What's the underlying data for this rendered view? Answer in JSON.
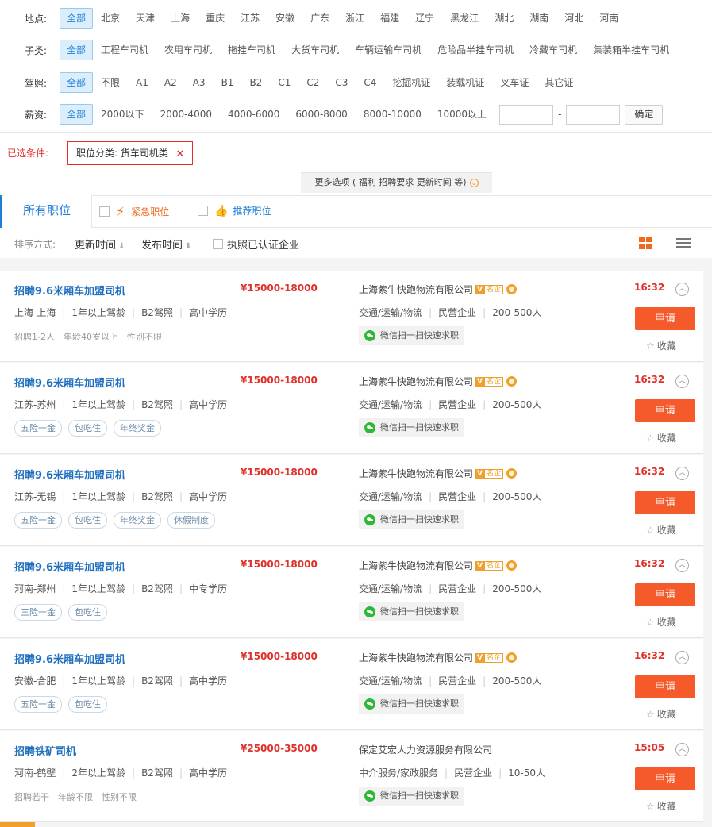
{
  "filters": {
    "location": {
      "label": "地点:",
      "options": [
        "全部",
        "北京",
        "天津",
        "上海",
        "重庆",
        "江苏",
        "安徽",
        "广东",
        "浙江",
        "福建",
        "辽宁",
        "黑龙江",
        "湖北",
        "湖南",
        "河北",
        "河南"
      ]
    },
    "subcategory": {
      "label": "子类:",
      "options": [
        "全部",
        "工程车司机",
        "农用车司机",
        "拖挂车司机",
        "大货车司机",
        "车辆运输车司机",
        "危险品半挂车司机",
        "冷藏车司机",
        "集装箱半挂车司机"
      ]
    },
    "license": {
      "label": "驾照:",
      "options": [
        "全部",
        "不限",
        "A1",
        "A2",
        "A3",
        "B1",
        "B2",
        "C1",
        "C2",
        "C3",
        "C4",
        "挖掘机证",
        "装载机证",
        "叉车证",
        "其它证"
      ]
    },
    "salary": {
      "label": "薪资:",
      "options": [
        "全部",
        "2000以下",
        "2000-4000",
        "4000-6000",
        "6000-8000",
        "8000-10000",
        "10000以上"
      ],
      "dash": "-",
      "confirm_label": "确定"
    }
  },
  "selected": {
    "label": "已选条件:",
    "tag": "职位分类: 货车司机类",
    "remove": "×"
  },
  "more_options": "更多选项 ( 福利 招聘要求 更新时间 等)",
  "tabs": {
    "all": "所有职位",
    "urgent": "紧急职位",
    "recommend": "推荐职位"
  },
  "sort": {
    "label": "排序方式:",
    "update_time": "更新时间",
    "publish_time": "发布时间",
    "certified": "执照已认证企业",
    "arrow": "⬇"
  },
  "jobs": [
    {
      "title": "招聘9.6米厢车加盟司机",
      "salary": "¥15000-18000",
      "location": "上海-上海",
      "experience": "1年以上驾龄",
      "license": "B2驾照",
      "education": "高中学历",
      "extra": [
        "招聘1-2人",
        "年龄40岁以上",
        "性别不限"
      ],
      "tags": [],
      "company": "上海紫牛快跑物流有限公司",
      "badge": "名企",
      "industry": "交通/运输/物流",
      "ownership": "民营企业",
      "size": "200-500人",
      "wechat": "微信扫一扫快速求职",
      "time": "16:32",
      "apply": "申请",
      "fav": "收藏"
    },
    {
      "title": "招聘9.6米厢车加盟司机",
      "salary": "¥15000-18000",
      "location": "江苏-苏州",
      "experience": "1年以上驾龄",
      "license": "B2驾照",
      "education": "高中学历",
      "extra": [],
      "tags": [
        "五险一金",
        "包吃住",
        "年终奖金"
      ],
      "company": "上海紫牛快跑物流有限公司",
      "badge": "名企",
      "industry": "交通/运输/物流",
      "ownership": "民营企业",
      "size": "200-500人",
      "wechat": "微信扫一扫快速求职",
      "time": "16:32",
      "apply": "申请",
      "fav": "收藏"
    },
    {
      "title": "招聘9.6米厢车加盟司机",
      "salary": "¥15000-18000",
      "location": "江苏-无锡",
      "experience": "1年以上驾龄",
      "license": "B2驾照",
      "education": "高中学历",
      "extra": [],
      "tags": [
        "五险一金",
        "包吃住",
        "年终奖金",
        "休假制度"
      ],
      "company": "上海紫牛快跑物流有限公司",
      "badge": "名企",
      "industry": "交通/运输/物流",
      "ownership": "民营企业",
      "size": "200-500人",
      "wechat": "微信扫一扫快速求职",
      "time": "16:32",
      "apply": "申请",
      "fav": "收藏"
    },
    {
      "title": "招聘9.6米厢车加盟司机",
      "salary": "¥15000-18000",
      "location": "河南-郑州",
      "experience": "1年以上驾龄",
      "license": "B2驾照",
      "education": "中专学历",
      "extra": [],
      "tags": [
        "三险一金",
        "包吃住"
      ],
      "company": "上海紫牛快跑物流有限公司",
      "badge": "名企",
      "industry": "交通/运输/物流",
      "ownership": "民营企业",
      "size": "200-500人",
      "wechat": "微信扫一扫快速求职",
      "time": "16:32",
      "apply": "申请",
      "fav": "收藏"
    },
    {
      "title": "招聘9.6米厢车加盟司机",
      "salary": "¥15000-18000",
      "location": "安徽-合肥",
      "experience": "1年以上驾龄",
      "license": "B2驾照",
      "education": "高中学历",
      "extra": [],
      "tags": [
        "五险一金",
        "包吃住"
      ],
      "company": "上海紫牛快跑物流有限公司",
      "badge": "名企",
      "industry": "交通/运输/物流",
      "ownership": "民营企业",
      "size": "200-500人",
      "wechat": "微信扫一扫快速求职",
      "time": "16:32",
      "apply": "申请",
      "fav": "收藏"
    },
    {
      "title": "招聘铁矿司机",
      "salary": "¥25000-35000",
      "location": "河南-鹤壁",
      "experience": "2年以上驾龄",
      "license": "B2驾照",
      "education": "高中学历",
      "extra": [
        "招聘若干",
        "年龄不限",
        "性别不限"
      ],
      "tags": [],
      "company": "保定艾宏人力资源服务有限公司",
      "badge": "",
      "industry": "中介服务/家政服务",
      "ownership": "民营企业",
      "size": "10-50人",
      "wechat": "微信扫一扫快速求职",
      "time": "15:05",
      "apply": "申请",
      "fav": "收藏"
    }
  ],
  "colors": {
    "accent_blue": "#1f7fd6",
    "accent_red": "#e0302a",
    "apply_orange": "#f55a2a",
    "badge_orange": "#f0a02a",
    "wechat_green": "#2db835"
  }
}
